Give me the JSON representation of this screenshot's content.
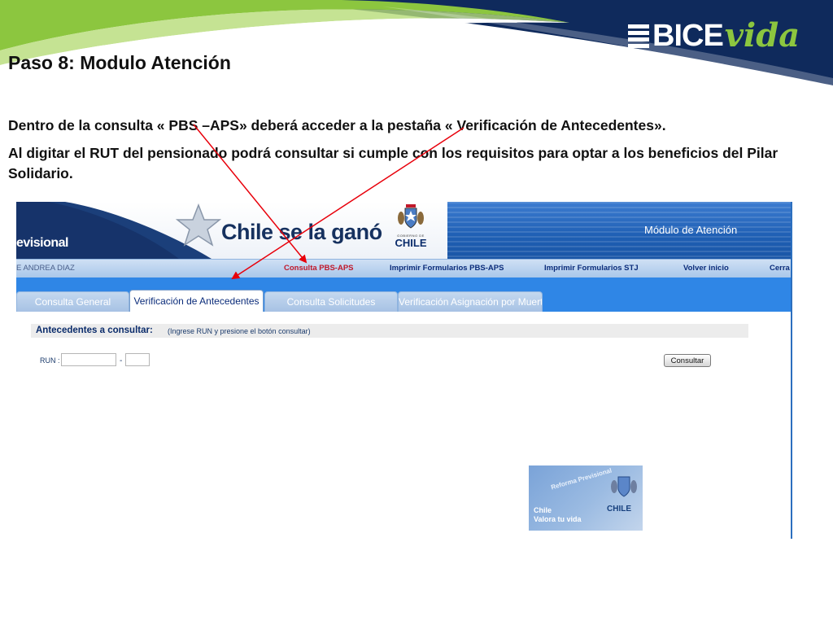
{
  "slide": {
    "title": "Paso 8: Modulo Atención",
    "paragraph_1": "Dentro de la consulta « PBS –APS» deberá acceder a la pestaña « Verificación de Antecedentes».",
    "paragraph_2": "Al digitar el RUT del pensionado podrá consultar si cumple con los requisitos para optar a los beneficios del Pilar Solidario."
  },
  "logo": {
    "bice": "BICE",
    "vida": "vida"
  },
  "app": {
    "header": {
      "partial_label": "evisional",
      "slogan": "Chile se la ganó",
      "crest_gob": "GOBIERNO DE",
      "crest_chile": "CHILE",
      "module_title": "Módulo de Atención"
    },
    "nav": {
      "user": "E ANDREA DIAZ",
      "items": [
        "Consulta PBS-APS",
        "Imprimir Formularios PBS-APS",
        "Imprimir Formularios STJ",
        "Volver inicio",
        "Cerra"
      ]
    },
    "tabs": [
      "Consulta General",
      "Verificación de Antecedentes",
      "Consulta Solicitudes",
      "Verificación Asignación por Muerte"
    ],
    "form": {
      "bar_title": "Antecedentes a consultar:",
      "bar_hint": "(Ingrese RUN y presione el botón consultar)",
      "run_label": "RUN :",
      "separator": "-",
      "run_value": "",
      "dv_value": "",
      "button": "Consultar"
    },
    "image": {
      "reforma": "Reforma Previsional",
      "line1": "Chile",
      "line2": "Valora tu vida",
      "crest_chile": "CHILE"
    }
  },
  "colors": {
    "navy": "#0f2a5c",
    "green": "#8cc63f",
    "tab_blue": "#2f86e6",
    "arrow_red": "#e8000b"
  }
}
